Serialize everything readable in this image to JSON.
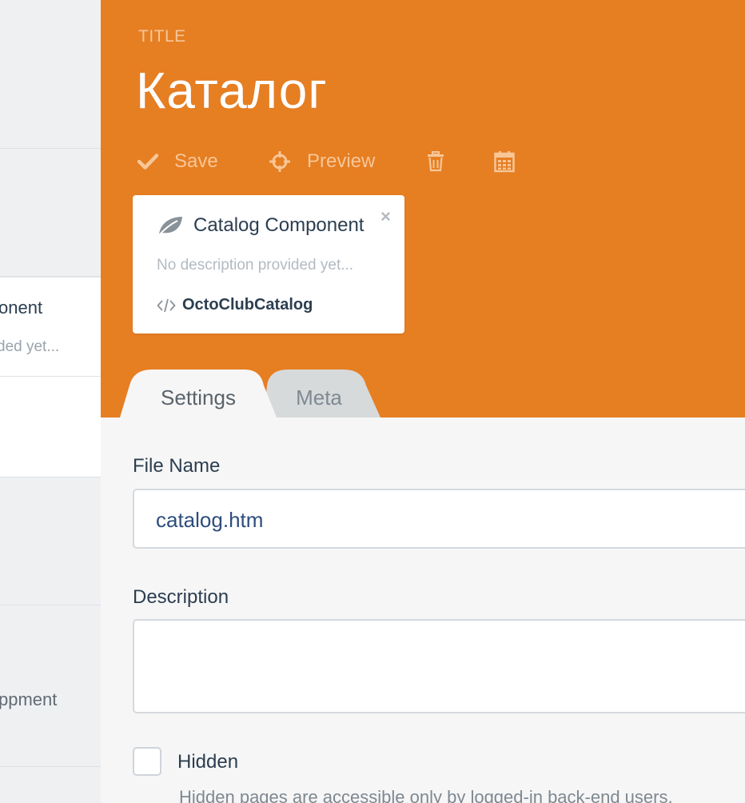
{
  "sidebar": {
    "item_title_fragment": "onent",
    "item_desc_fragment": "ded yet...",
    "item_text_fragment": "ppment"
  },
  "header": {
    "title_label": "TITLE",
    "page_title": "Каталог",
    "background_color": "#e67e22"
  },
  "toolbar": {
    "save_label": "Save",
    "preview_label": "Preview",
    "save_icon": "checkmark-icon",
    "preview_icon": "crosshair-icon",
    "delete_icon": "trash-icon",
    "schedule_icon": "calendar-icon"
  },
  "component_card": {
    "title": "Catalog Component",
    "description": "No description provided yet...",
    "alias": "OctoClubCatalog",
    "icon": "leaf-icon",
    "close_symbol": "×"
  },
  "tabs": [
    {
      "label": "Settings",
      "active": true
    },
    {
      "label": "Meta",
      "active": false
    }
  ],
  "form": {
    "file_name_label": "File Name",
    "file_name_value": "catalog.htm",
    "description_label": "Description",
    "description_value": "",
    "hidden_label": "Hidden",
    "hidden_checked": false,
    "hidden_help": "Hidden pages are accessible only by logged-in back-end users."
  }
}
